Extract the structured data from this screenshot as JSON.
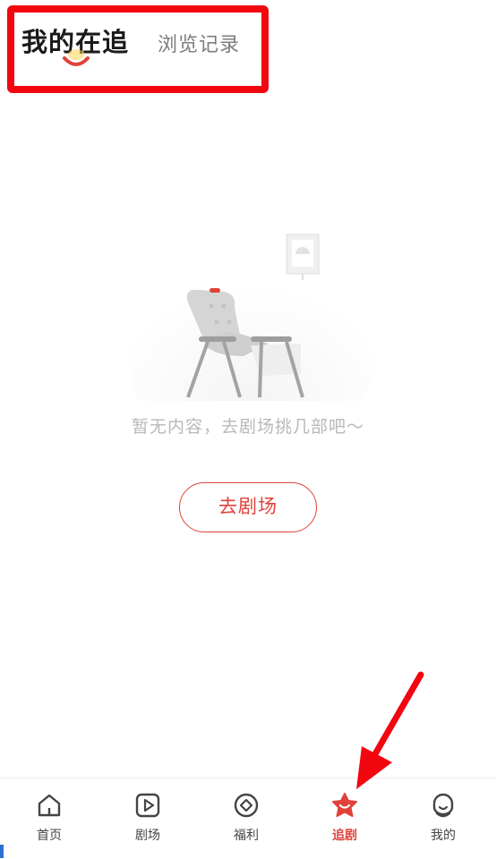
{
  "header": {
    "tabs": [
      {
        "label": "我的在追",
        "active": true
      },
      {
        "label": "浏览记录",
        "active": false
      }
    ]
  },
  "empty_state": {
    "illustration": "armchair-illustration",
    "message": "暂无内容，去剧场挑几部吧～",
    "button_label": "去剧场"
  },
  "tabbar": {
    "items": [
      {
        "label": "首页",
        "icon": "home-icon",
        "active": false
      },
      {
        "label": "剧场",
        "icon": "play-icon",
        "active": false
      },
      {
        "label": "福利",
        "icon": "coin-icon",
        "active": false
      },
      {
        "label": "追剧",
        "icon": "star-icon",
        "active": true
      },
      {
        "label": "我的",
        "icon": "profile-icon",
        "active": false
      }
    ]
  },
  "colors": {
    "accent": "#e0423a",
    "highlight_box": "#f2060f",
    "annotation_arrow": "#f2060f"
  }
}
